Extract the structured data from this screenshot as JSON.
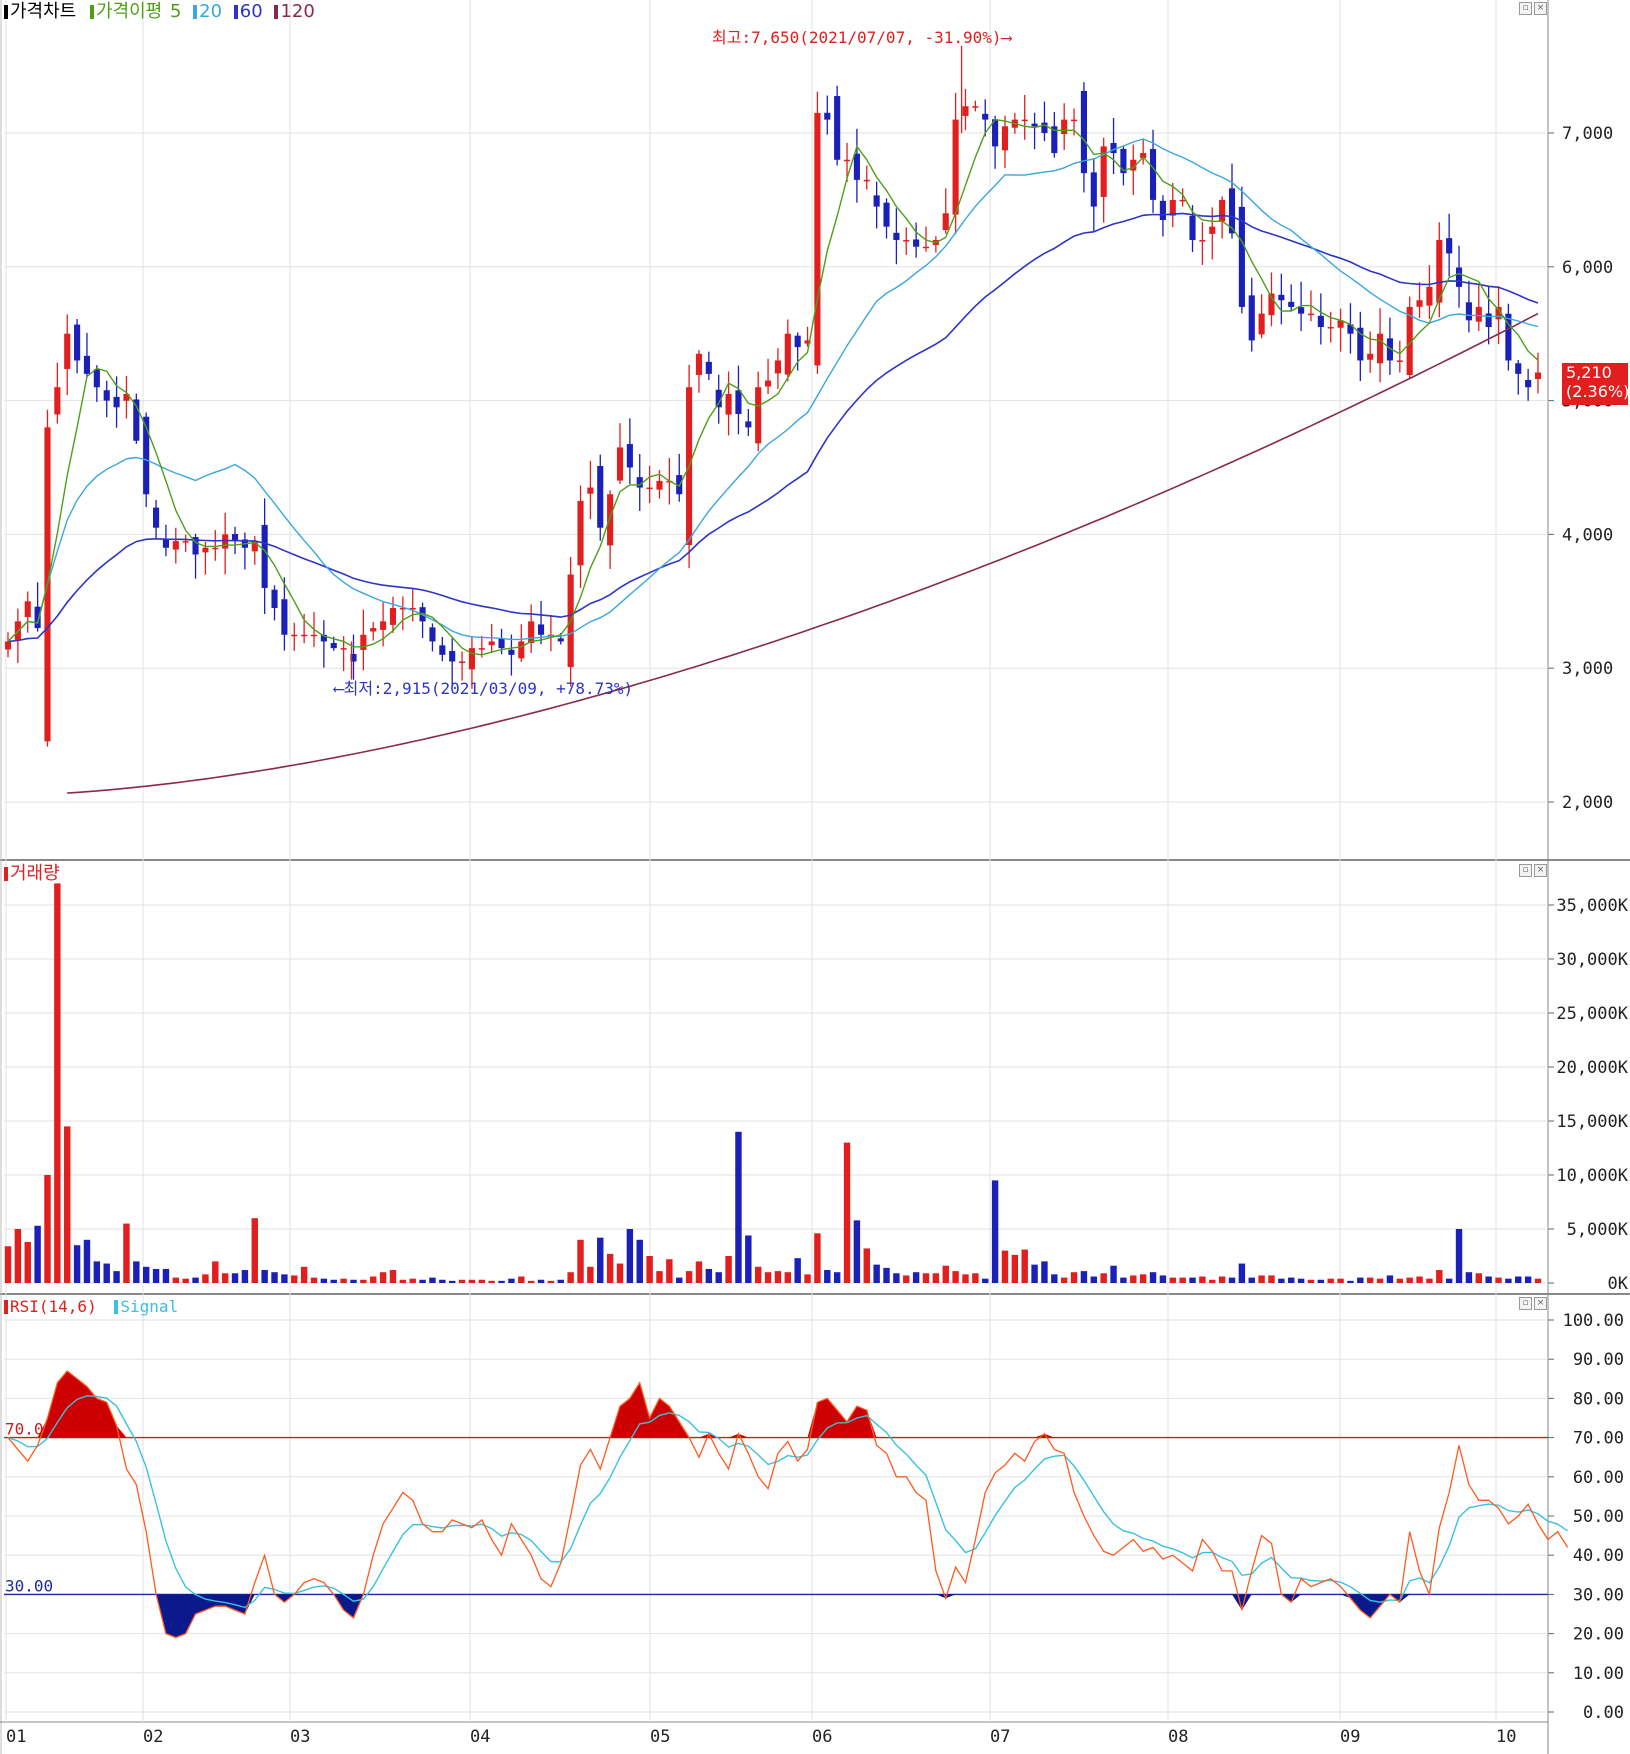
{
  "legend_price": {
    "title": "가격차트",
    "ma_label": "가격이평",
    "ma5": "5",
    "ma20": "20",
    "ma60": "60",
    "ma120": "120"
  },
  "legend_volume": {
    "title": "거래량"
  },
  "legend_rsi": {
    "title": "RSI(14,6)",
    "signal": "Signal"
  },
  "current_price": {
    "value": "5,210",
    "change": "(2.36%)"
  },
  "colors": {
    "up": "#e11f1f",
    "down": "#1a20b8",
    "ma5": "#4f9e1a",
    "ma20": "#39a7e0",
    "ma60": "#2c35c8",
    "ma120": "#8a2a4a",
    "rsi": "#ff5a1f",
    "signal": "#39c2e0",
    "grid": "#e2e2e2",
    "rsi_high_fill": "#cc0000",
    "rsi_low_fill": "#0a1a8c"
  },
  "chart_data": [
    {
      "type": "candlestick",
      "title": "가격차트",
      "x_tick_labels": [
        "01",
        "02",
        "03",
        "04",
        "05",
        "06",
        "07",
        "08",
        "09",
        "10"
      ],
      "y_ticks": [
        2000,
        3000,
        4000,
        5000,
        6000,
        7000
      ],
      "y_tick_labels": [
        "2,000",
        "3,000",
        "4,000",
        "5,000",
        "6,000",
        "7,000"
      ],
      "ylim": [
        1800,
        7400
      ],
      "annotations": {
        "high": "최고:7,650(2021/07/07, -31.90%)",
        "low": "최저:2,915(2021/03/09, +78.73%)"
      },
      "ohlc_close": [
        3200,
        3350,
        3500,
        3300,
        4800,
        5100,
        5500,
        5300,
        5200,
        5100,
        5000,
        4950,
        5050,
        4700,
        4300,
        4050,
        3900,
        3950,
        3950,
        3850,
        3900,
        3900,
        4000,
        3950,
        3900,
        3950,
        3600,
        3450,
        3250,
        3250,
        3250,
        3250,
        3200,
        3150,
        3150,
        3050,
        3250,
        3300,
        3350,
        3450,
        3450,
        3450,
        3350,
        3200,
        3100,
        3050,
        3050,
        3150,
        3150,
        3200,
        3150,
        3100,
        3200,
        3350,
        3250,
        3250,
        3200,
        3700,
        4250,
        4350,
        4050,
        4300,
        4650,
        4500,
        4350,
        4350,
        4400,
        4400,
        4300,
        5100,
        5350,
        5200,
        4950,
        5050,
        4900,
        4800,
        5100,
        5150,
        5300,
        5500,
        5400,
        5450,
        7150,
        7100,
        6800,
        6800,
        6650,
        6650,
        6450,
        6300,
        6200,
        6200,
        6150,
        6150,
        6200,
        6400,
        7100,
        7200,
        7200,
        7100,
        6900,
        7050,
        7100,
        7100,
        7050,
        7000,
        6850,
        7100,
        7100,
        6700,
        6450,
        6900,
        6850,
        6700,
        6800,
        6850,
        6500,
        6350,
        6500,
        6500,
        6200,
        6200,
        6300,
        6500,
        6250,
        5700,
        5450,
        5650,
        5800,
        5750,
        5700,
        5650,
        5650,
        5550,
        5550,
        5600,
        5500,
        5300,
        5350,
        5500,
        5300,
        5300,
        5700,
        5750,
        5850,
        6200,
        6100,
        5850,
        5600,
        5700,
        5550,
        5700,
        5300,
        5200,
        5100,
        5210
      ],
      "series": [
        {
          "name": "5",
          "values": []
        },
        {
          "name": "20",
          "values": []
        },
        {
          "name": "60",
          "values": []
        },
        {
          "name": "120",
          "values": []
        }
      ]
    },
    {
      "type": "bar",
      "title": "거래량",
      "y_ticks": [
        0,
        5000,
        10000,
        15000,
        20000,
        25000,
        30000,
        35000
      ],
      "y_tick_labels": [
        "0K",
        "5,000K",
        "10,000K",
        "15,000K",
        "20,000K",
        "25,000K",
        "30,000K",
        "35,000K"
      ],
      "ylim": [
        0,
        37000
      ],
      "values": [
        3400,
        5000,
        3800,
        5300,
        10000,
        37000,
        14500,
        3500,
        4000,
        2000,
        1800,
        1100,
        5500,
        2000,
        1500,
        1300,
        1300,
        500,
        400,
        500,
        800,
        2000,
        900,
        900,
        1200,
        6000,
        1200,
        1000,
        800,
        700,
        1500,
        500,
        400,
        300,
        400,
        300,
        300,
        600,
        1000,
        1200,
        300,
        400,
        300,
        500,
        300,
        200,
        300,
        300,
        300,
        200,
        200,
        400,
        600,
        200,
        300,
        200,
        300,
        1000,
        4000,
        1500,
        4200,
        2700,
        1800,
        5000,
        4000,
        2500,
        1100,
        2200,
        500,
        1100,
        2000,
        1300,
        1000,
        2500,
        14000,
        4400,
        1500,
        1000,
        1100,
        1000,
        2300,
        800,
        4600,
        1200,
        1000,
        13000,
        5800,
        3200,
        1700,
        1400,
        900,
        700,
        1000,
        900,
        900,
        1600,
        1100,
        800,
        900,
        400,
        9500,
        3000,
        2600,
        3100,
        1700,
        2000,
        800,
        500,
        1000,
        1100,
        600,
        900,
        1600,
        500,
        700,
        800,
        1000,
        700,
        500,
        500,
        500,
        600,
        300,
        600,
        500,
        1800,
        500,
        700,
        700,
        400,
        500,
        400,
        300,
        300,
        400,
        400,
        200,
        500,
        500,
        400,
        700,
        400,
        500,
        600,
        400,
        1200,
        400,
        5000,
        1000,
        900,
        600,
        500,
        400,
        600,
        600,
        400
      ],
      "colors_up": true
    },
    {
      "type": "line",
      "title": "RSI(14,6)",
      "y_ticks": [
        0,
        10,
        20,
        30,
        40,
        50,
        60,
        70,
        80,
        90,
        100
      ],
      "y_tick_labels": [
        "0.00",
        "10.00",
        "20.00",
        "30.00",
        "40.00",
        "50.00",
        "60.00",
        "70.00",
        "80.00",
        "90.00",
        "100.00"
      ],
      "ylim": [
        0,
        100
      ],
      "reference_lines": [
        {
          "value": 70,
          "label": "70.00"
        },
        {
          "value": 30,
          "label": "30.00"
        }
      ],
      "series": [
        {
          "name": "RSI(14,6)",
          "values": [
            70,
            67,
            64,
            68,
            75,
            84,
            87,
            85,
            83,
            80,
            79,
            73,
            62,
            58,
            46,
            30,
            20,
            19,
            20,
            25,
            26,
            27,
            27,
            26,
            25,
            33,
            40,
            30,
            28,
            30,
            33,
            34,
            33,
            30,
            26,
            24,
            30,
            40,
            48,
            52,
            56,
            54,
            48,
            46,
            46,
            49,
            48,
            47,
            49,
            44,
            40,
            48,
            44,
            40,
            34,
            32,
            38,
            50,
            63,
            67,
            62,
            70,
            78,
            80,
            84,
            75,
            80,
            78,
            74,
            70,
            65,
            71,
            66,
            62,
            71,
            66,
            60,
            57,
            66,
            69,
            64,
            67,
            79,
            80,
            77,
            74,
            78,
            77,
            68,
            66,
            60,
            60,
            56,
            54,
            36,
            29,
            37,
            33,
            44,
            56,
            61,
            63,
            66,
            64,
            69,
            71,
            67,
            66,
            56,
            50,
            45,
            41,
            40,
            42,
            44,
            41,
            42,
            39,
            40,
            38,
            36,
            44,
            41,
            36,
            36,
            26,
            36,
            45,
            43,
            30,
            28,
            34,
            32,
            33,
            34,
            32,
            29,
            26,
            24,
            27,
            30,
            28,
            46,
            36,
            30,
            47,
            56,
            68,
            58,
            54,
            54,
            52,
            48,
            50,
            53,
            48,
            44,
            46,
            42
          ]
        },
        {
          "name": "Signal",
          "values": []
        }
      ]
    }
  ]
}
